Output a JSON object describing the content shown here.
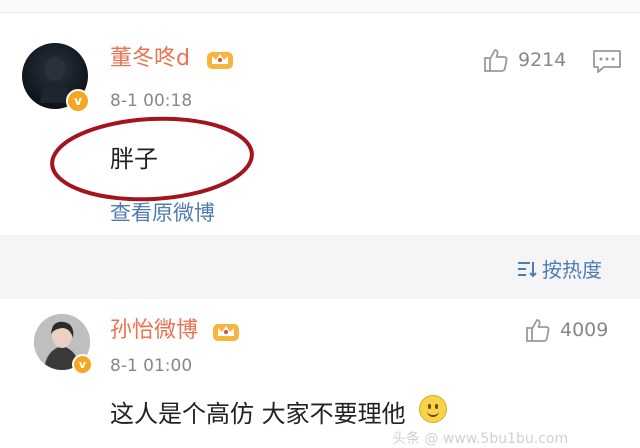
{
  "comments": [
    {
      "username": "董冬咚d",
      "timestamp": "8-1 00:18",
      "likes": "9214",
      "text": "胖子",
      "view_original": "查看原微博"
    },
    {
      "username": "孙怡微博",
      "timestamp": "8-1 01:00",
      "likes": "4009",
      "text": "这人是个高仿 大家不要理他"
    }
  ],
  "sort": {
    "label": "按热度"
  },
  "badge": {
    "letter": "v"
  },
  "watermark": "头条 @ www.5bu1bu.com",
  "colors": {
    "username": "#eb7350",
    "link": "#507daf",
    "annotation": "#a3141d",
    "badge": "#f5a623"
  },
  "icons": [
    "verified-badge-icon",
    "crown-icon",
    "thumbs-up-icon",
    "reply-icon",
    "sort-icon",
    "smile-emoji-icon"
  ]
}
